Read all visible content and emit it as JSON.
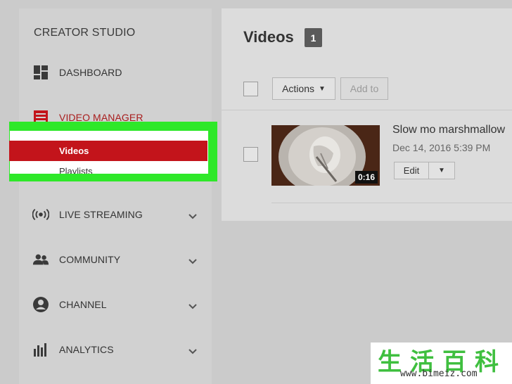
{
  "sidebar": {
    "title": "CREATOR STUDIO",
    "items": [
      {
        "label": "DASHBOARD",
        "icon": "dashboard-icon"
      },
      {
        "label": "VIDEO MANAGER",
        "icon": "video-manager-icon"
      },
      {
        "label": "LIVE STREAMING",
        "icon": "live-streaming-icon"
      },
      {
        "label": "COMMUNITY",
        "icon": "community-icon"
      },
      {
        "label": "CHANNEL",
        "icon": "channel-icon"
      },
      {
        "label": "ANALYTICS",
        "icon": "analytics-icon"
      }
    ],
    "subitems": {
      "videos": "Videos",
      "playlists": "Playlists"
    }
  },
  "main": {
    "title": "Videos",
    "count": "1",
    "actions_label": "Actions",
    "add_to_label": "Add to",
    "video": {
      "title": "Slow mo marshmallow",
      "date": "Dec 14, 2016 5:39 PM",
      "duration": "0:16",
      "edit_label": "Edit"
    }
  },
  "watermark": {
    "chinese": "生活百科",
    "url": "www.bimeiz.com"
  },
  "colors": {
    "accent_red": "#c3141b",
    "highlight_green": "#2ee829",
    "watermark_green": "#3fbf3f"
  }
}
